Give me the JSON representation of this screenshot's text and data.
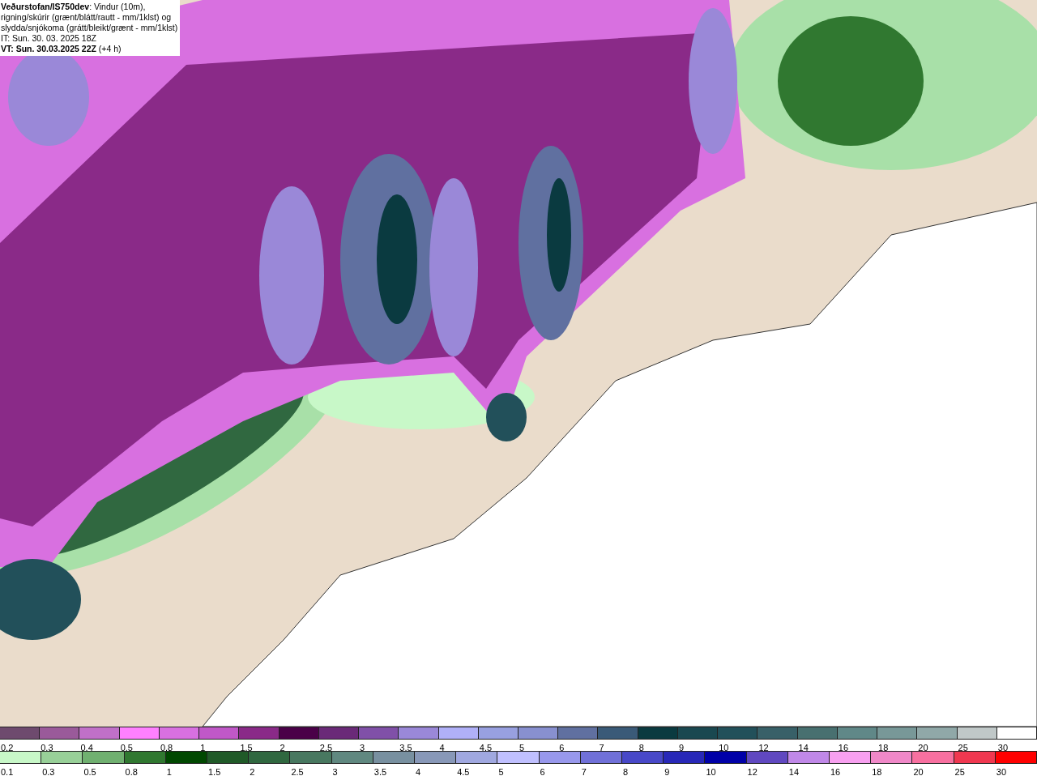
{
  "header": {
    "lines": [
      "**Veðurstofan/IS750dev**: Vindur (10m),",
      "rigning/skúrir (grænt/blátt/rautt - mm/1klst) og",
      "slydda/snjókoma (grátt/bleikt/grænt - mm/1klst)",
      "IT: Sun. 30. 03. 2025 18Z",
      "**VT: Sun. 30.03.2025 22Z** (+4 h)"
    ]
  },
  "legends": [
    {
      "swatches": [
        {
          "label": "0.2",
          "color": "#6e4a6e"
        },
        {
          "label": "0.3",
          "color": "#9a5a9a"
        },
        {
          "label": "0.4",
          "color": "#c070c8"
        },
        {
          "label": "0.5",
          "color": "#ff80ff"
        },
        {
          "label": "0.8",
          "color": "#d870e0"
        },
        {
          "label": "1",
          "color": "#c058c8"
        },
        {
          "label": "1.5",
          "color": "#8a2a88"
        },
        {
          "label": "2",
          "color": "#4a0048"
        },
        {
          "label": "2.5",
          "color": "#6a2a78"
        },
        {
          "label": "3",
          "color": "#8050a8"
        },
        {
          "label": "3.5",
          "color": "#9a88d8"
        },
        {
          "label": "4",
          "color": "#b0b0f8"
        },
        {
          "label": "4.5",
          "color": "#98a0e0"
        },
        {
          "label": "5",
          "color": "#8890d0"
        },
        {
          "label": "6",
          "color": "#6070a0"
        },
        {
          "label": "7",
          "color": "#3a5a78"
        },
        {
          "label": "8",
          "color": "#0a3a40"
        },
        {
          "label": "9",
          "color": "#1a4850"
        },
        {
          "label": "10",
          "color": "#22505a"
        },
        {
          "label": "12",
          "color": "#386068"
        },
        {
          "label": "14",
          "color": "#487070"
        },
        {
          "label": "16",
          "color": "#608888"
        },
        {
          "label": "18",
          "color": "#789898"
        },
        {
          "label": "20",
          "color": "#90a8a8"
        },
        {
          "label": "25",
          "color": "#c0c8c8"
        },
        {
          "label": "30",
          "color": "#ffffff"
        }
      ]
    },
    {
      "swatches": [
        {
          "label": "0.1",
          "color": "#c8f8c8"
        },
        {
          "label": "0.3",
          "color": "#98d098"
        },
        {
          "label": "0.5",
          "color": "#70b070"
        },
        {
          "label": "0.8",
          "color": "#307830"
        },
        {
          "label": "1",
          "color": "#004800"
        },
        {
          "label": "1.5",
          "color": "#205a28"
        },
        {
          "label": "2",
          "color": "#306840"
        },
        {
          "label": "2.5",
          "color": "#487860"
        },
        {
          "label": "3",
          "color": "#608880"
        },
        {
          "label": "3.5",
          "color": "#7890a0"
        },
        {
          "label": "4",
          "color": "#8898b8"
        },
        {
          "label": "4.5",
          "color": "#a0a8e0"
        },
        {
          "label": "5",
          "color": "#c0c0ff"
        },
        {
          "label": "6",
          "color": "#9898ec"
        },
        {
          "label": "7",
          "color": "#7070d8"
        },
        {
          "label": "8",
          "color": "#4848c8"
        },
        {
          "label": "9",
          "color": "#2828b8"
        },
        {
          "label": "10",
          "color": "#0000a8"
        },
        {
          "label": "12",
          "color": "#6048c0"
        },
        {
          "label": "14",
          "color": "#c088e8"
        },
        {
          "label": "16",
          "color": "#f8a0f0"
        },
        {
          "label": "18",
          "color": "#f088c8"
        },
        {
          "label": "20",
          "color": "#f870a0"
        },
        {
          "label": "25",
          "color": "#f03850"
        },
        {
          "label": "30",
          "color": "#ff0000"
        }
      ]
    }
  ]
}
